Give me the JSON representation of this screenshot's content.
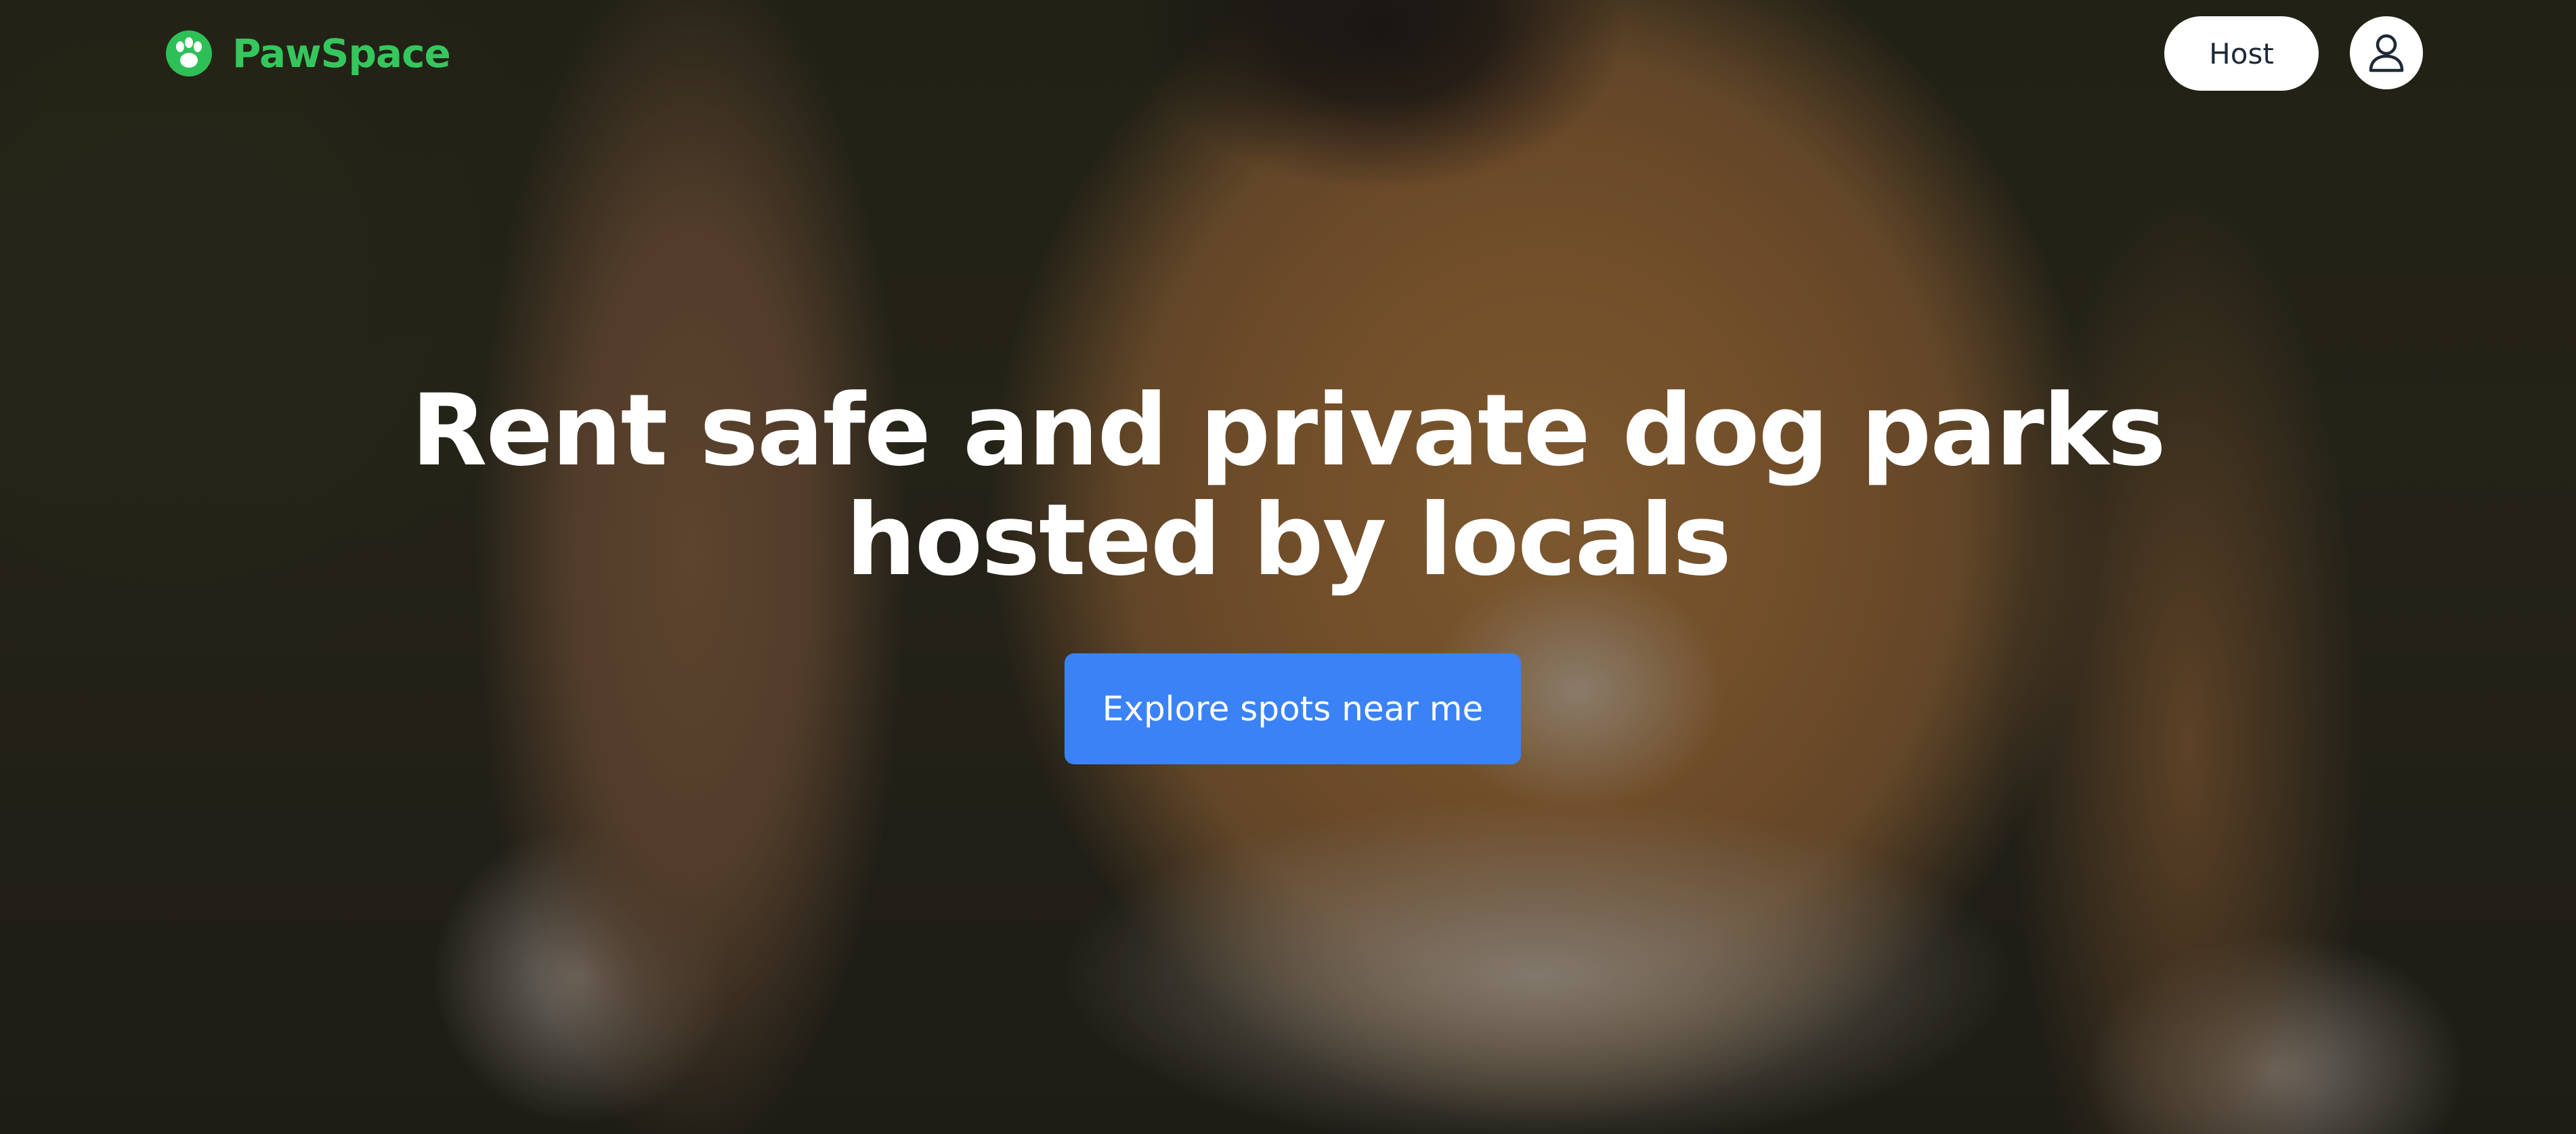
{
  "brand": {
    "name": "PawSpace",
    "icon": "paw-icon",
    "color": "#35c75d"
  },
  "nav": {
    "host_label": "Host",
    "profile_icon": "user-icon"
  },
  "hero": {
    "headline": "Rent safe and private dog parks hosted by locals",
    "cta_label": "Explore spots near me",
    "cta_color": "#3b82f6",
    "background": "photo of a golden dog sitting on grass"
  }
}
